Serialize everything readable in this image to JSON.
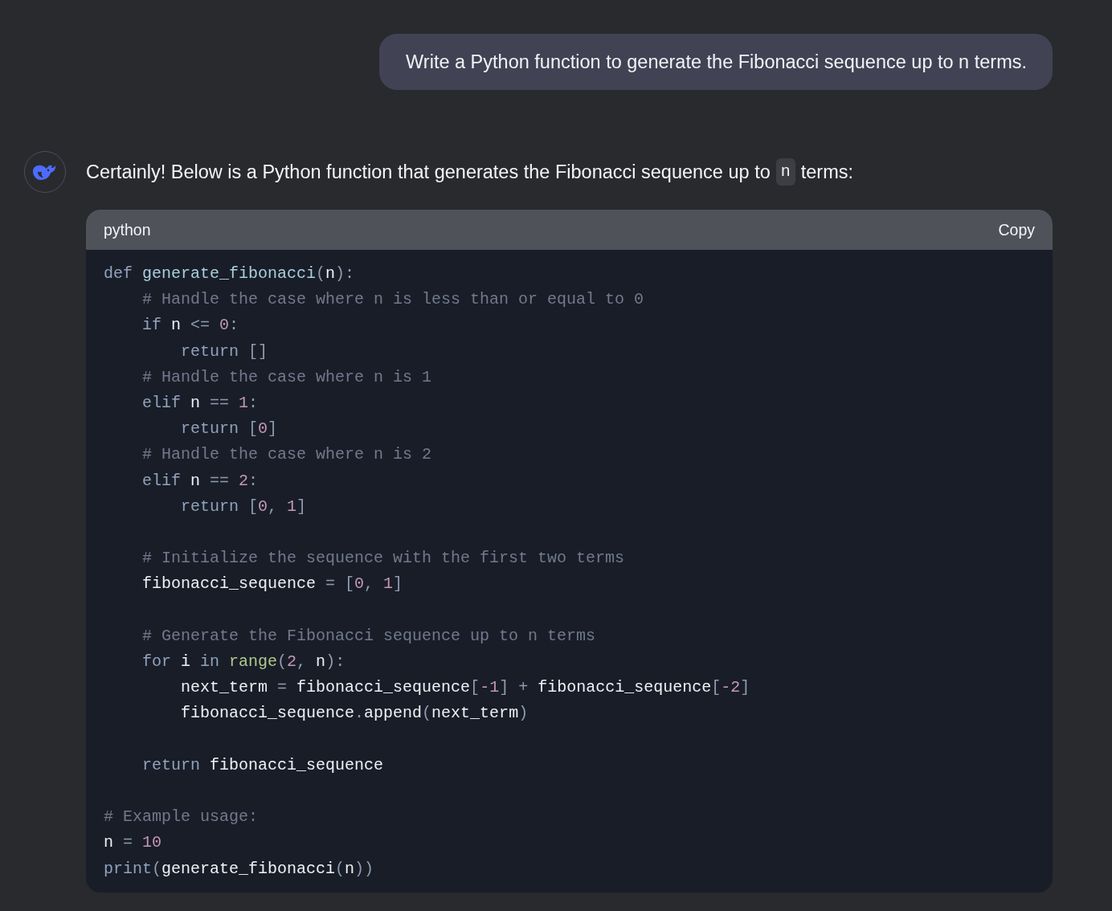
{
  "user_message": {
    "text": "Write a Python function to generate the Fibonacci sequence up to n terms."
  },
  "answer": {
    "intro_before": "Certainly! Below is a Python function that generates the Fibonacci sequence up to",
    "intro_code": "n",
    "intro_after": "terms:",
    "code_block": {
      "language": "python",
      "copy_label": "Copy",
      "lines": [
        {
          "kind": "code",
          "tokens": [
            {
              "text": "def ",
              "kind": "keyword"
            },
            {
              "text": "generate_fibonacci",
              "kind": "function"
            },
            {
              "text": "(",
              "kind": "punct"
            },
            {
              "text": "n",
              "kind": "plain"
            },
            {
              "text": "):",
              "kind": "punct"
            }
          ]
        },
        {
          "kind": "code",
          "tokens": [
            {
              "text": "    # Handle the case where n is less than or equal to 0",
              "kind": "comment"
            }
          ]
        },
        {
          "kind": "code",
          "tokens": [
            {
              "text": "    if",
              "kind": "keyword"
            },
            {
              "text": " n ",
              "kind": "plain"
            },
            {
              "text": "<= ",
              "kind": "punct"
            },
            {
              "text": "0",
              "kind": "number"
            },
            {
              "text": ":",
              "kind": "punct"
            }
          ]
        },
        {
          "kind": "code",
          "tokens": [
            {
              "text": "        return ",
              "kind": "keyword"
            },
            {
              "text": "[]",
              "kind": "punct"
            }
          ]
        },
        {
          "kind": "code",
          "tokens": [
            {
              "text": "    # Handle the case where n is 1",
              "kind": "comment"
            }
          ]
        },
        {
          "kind": "code",
          "tokens": [
            {
              "text": "    elif",
              "kind": "keyword"
            },
            {
              "text": " n ",
              "kind": "plain"
            },
            {
              "text": "== ",
              "kind": "punct"
            },
            {
              "text": "1",
              "kind": "number"
            },
            {
              "text": ":",
              "kind": "punct"
            }
          ]
        },
        {
          "kind": "code",
          "tokens": [
            {
              "text": "        return ",
              "kind": "keyword"
            },
            {
              "text": "[",
              "kind": "punct"
            },
            {
              "text": "0",
              "kind": "number"
            },
            {
              "text": "]",
              "kind": "punct"
            }
          ]
        },
        {
          "kind": "code",
          "tokens": [
            {
              "text": "    # Handle the case where n is 2",
              "kind": "comment"
            }
          ]
        },
        {
          "kind": "code",
          "tokens": [
            {
              "text": "    elif",
              "kind": "keyword"
            },
            {
              "text": " n ",
              "kind": "plain"
            },
            {
              "text": "== ",
              "kind": "punct"
            },
            {
              "text": "2",
              "kind": "number"
            },
            {
              "text": ":",
              "kind": "punct"
            }
          ]
        },
        {
          "kind": "code",
          "tokens": [
            {
              "text": "        return ",
              "kind": "keyword"
            },
            {
              "text": "[",
              "kind": "punct"
            },
            {
              "text": "0",
              "kind": "number"
            },
            {
              "text": ", ",
              "kind": "punct"
            },
            {
              "text": "1",
              "kind": "number"
            },
            {
              "text": "]",
              "kind": "punct"
            }
          ]
        },
        {
          "kind": "blank"
        },
        {
          "kind": "code",
          "tokens": [
            {
              "text": "    # Initialize the sequence with the first two terms",
              "kind": "comment"
            }
          ]
        },
        {
          "kind": "code",
          "tokens": [
            {
              "text": "    fibonacci_sequence ",
              "kind": "plain"
            },
            {
              "text": "= [",
              "kind": "punct"
            },
            {
              "text": "0",
              "kind": "number"
            },
            {
              "text": ", ",
              "kind": "punct"
            },
            {
              "text": "1",
              "kind": "number"
            },
            {
              "text": "]",
              "kind": "punct"
            }
          ]
        },
        {
          "kind": "blank"
        },
        {
          "kind": "code",
          "tokens": [
            {
              "text": "    # Generate the Fibonacci sequence up to n terms",
              "kind": "comment"
            }
          ]
        },
        {
          "kind": "code",
          "tokens": [
            {
              "text": "    for",
              "kind": "keyword"
            },
            {
              "text": " i ",
              "kind": "plain"
            },
            {
              "text": "in ",
              "kind": "keyword"
            },
            {
              "text": "range",
              "kind": "builtin"
            },
            {
              "text": "(",
              "kind": "punct"
            },
            {
              "text": "2",
              "kind": "number"
            },
            {
              "text": ", ",
              "kind": "punct"
            },
            {
              "text": "n",
              "kind": "plain"
            },
            {
              "text": "):",
              "kind": "punct"
            }
          ]
        },
        {
          "kind": "code",
          "tokens": [
            {
              "text": "        next_term ",
              "kind": "plain"
            },
            {
              "text": "=",
              "kind": "punct"
            },
            {
              "text": " fibonacci_sequence",
              "kind": "plain"
            },
            {
              "text": "[",
              "kind": "punct"
            },
            {
              "text": "-1",
              "kind": "number"
            },
            {
              "text": "] +",
              "kind": "punct"
            },
            {
              "text": " fibonacci_sequence",
              "kind": "plain"
            },
            {
              "text": "[",
              "kind": "punct"
            },
            {
              "text": "-2",
              "kind": "number"
            },
            {
              "text": "]",
              "kind": "punct"
            }
          ]
        },
        {
          "kind": "code",
          "tokens": [
            {
              "text": "        fibonacci_sequence",
              "kind": "plain"
            },
            {
              "text": ".",
              "kind": "punct"
            },
            {
              "text": "append",
              "kind": "plain"
            },
            {
              "text": "(",
              "kind": "punct"
            },
            {
              "text": "next_term",
              "kind": "plain"
            },
            {
              "text": ")",
              "kind": "punct"
            }
          ]
        },
        {
          "kind": "blank"
        },
        {
          "kind": "code",
          "tokens": [
            {
              "text": "    return",
              "kind": "keyword"
            },
            {
              "text": " fibonacci_sequence",
              "kind": "plain"
            }
          ]
        },
        {
          "kind": "blank"
        },
        {
          "kind": "code",
          "tokens": [
            {
              "text": "# Example usage:",
              "kind": "comment"
            }
          ]
        },
        {
          "kind": "code",
          "tokens": [
            {
              "text": "n ",
              "kind": "plain"
            },
            {
              "text": "= ",
              "kind": "punct"
            },
            {
              "text": "10",
              "kind": "number"
            }
          ]
        },
        {
          "kind": "code",
          "tokens": [
            {
              "text": "print",
              "kind": "keyword"
            },
            {
              "text": "(",
              "kind": "punct"
            },
            {
              "text": "generate_fibonacci",
              "kind": "plain"
            },
            {
              "text": "(",
              "kind": "punct"
            },
            {
              "text": "n",
              "kind": "plain"
            },
            {
              "text": "))",
              "kind": "punct"
            }
          ]
        }
      ]
    }
  }
}
